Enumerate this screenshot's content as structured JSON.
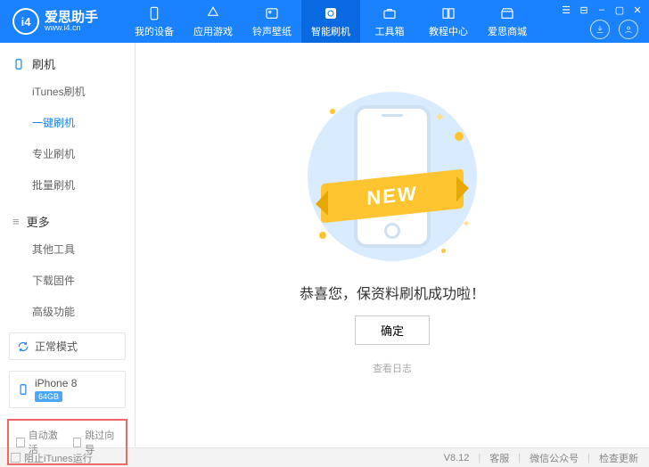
{
  "logo": {
    "badge": "i4",
    "name": "爱思助手",
    "url": "www.i4.cn"
  },
  "nav": [
    {
      "label": "我的设备"
    },
    {
      "label": "应用游戏"
    },
    {
      "label": "铃声壁纸"
    },
    {
      "label": "智能刷机"
    },
    {
      "label": "工具箱"
    },
    {
      "label": "教程中心"
    },
    {
      "label": "爱思商城"
    }
  ],
  "sidebar": {
    "section1": "刷机",
    "items1": [
      "iTunes刷机",
      "一键刷机",
      "专业刷机",
      "批量刷机"
    ],
    "section2": "更多",
    "items2": [
      "其他工具",
      "下载固件",
      "高级功能"
    ]
  },
  "mode": {
    "label": "正常模式"
  },
  "device": {
    "name": "iPhone 8",
    "storage": "64GB"
  },
  "checkbox1": "自动激活",
  "checkbox2": "跳过向导",
  "main": {
    "ribbon": "NEW",
    "msg": "恭喜您，保资料刷机成功啦！",
    "ok": "确定",
    "log": "查看日志"
  },
  "footer": {
    "block": "阻止iTunes运行",
    "version": "V8.12",
    "links": [
      "客服",
      "微信公众号",
      "检查更新"
    ]
  }
}
